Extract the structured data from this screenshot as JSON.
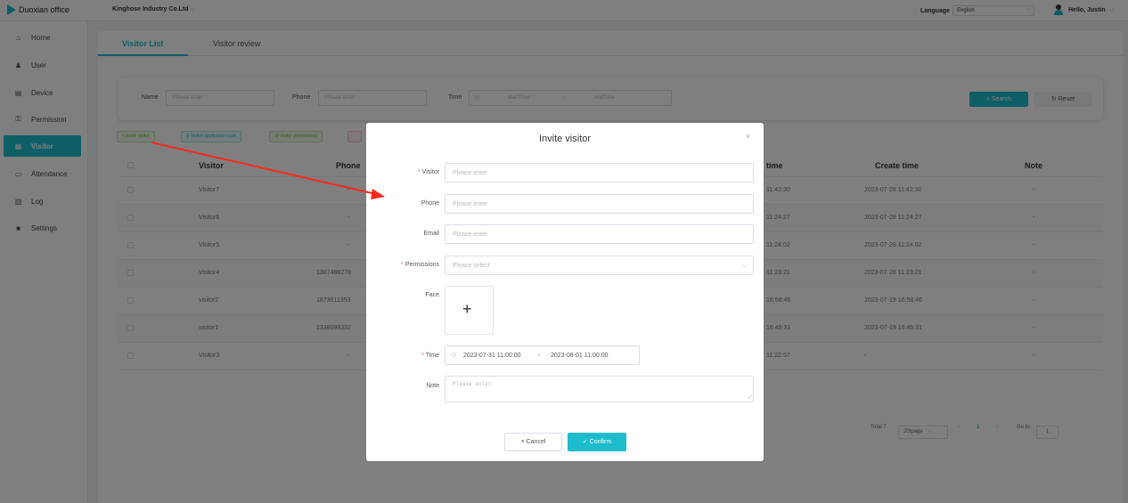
{
  "header": {
    "app_name": "Duoxian office",
    "company": "Kinghose Industry Co.Ltd",
    "language_label": "Language",
    "language_value": "English",
    "greeting": "Hello, Justin"
  },
  "sidebar": {
    "items": [
      {
        "label": "Home",
        "icon": "home-icon"
      },
      {
        "label": "User",
        "icon": "user-icon"
      },
      {
        "label": "Device",
        "icon": "device-icon"
      },
      {
        "label": "Permission",
        "icon": "permission-icon"
      },
      {
        "label": "Visitor",
        "icon": "visitor-icon",
        "active": true
      },
      {
        "label": "Attendance",
        "icon": "attendance-icon"
      },
      {
        "label": "Log",
        "icon": "log-icon"
      },
      {
        "label": "Settings",
        "icon": "settings-icon"
      }
    ]
  },
  "tabs": [
    {
      "label": "Visitor List",
      "active": true
    },
    {
      "label": "Visitor review",
      "active": false
    }
  ],
  "filter": {
    "name_label": "Name",
    "name_placeholder": "Please enter",
    "phone_label": "Phone",
    "phone_placeholder": "Please enter",
    "time_label": "Time",
    "start_placeholder": "startTime",
    "time_separator": "-",
    "end_placeholder": "endTime",
    "search_label": "Search",
    "reset_label": "Reset"
  },
  "toolbar": {
    "invite": "+ Invite visitor",
    "app_code": "Visitor application code",
    "permissions": "Visitor permissions"
  },
  "table": {
    "columns": {
      "visitor": "Visitor",
      "phone": "Phone",
      "time": "time",
      "create_time": "Create time",
      "note": "Note"
    },
    "rows": [
      {
        "visitor": "Visitor7",
        "phone": "-",
        "time": "11:42:30",
        "create": "2023-07-28 11:42:30",
        "note": "-"
      },
      {
        "visitor": "Visitor6",
        "phone": "-",
        "time": "11:24:27",
        "create": "2023-07-28 11:24:27",
        "note": "-"
      },
      {
        "visitor": "Visitor5",
        "phone": "-",
        "time": "11:24:02",
        "create": "2023-07-28 11:24:02",
        "note": "-"
      },
      {
        "visitor": "Visitor4",
        "phone": "1387488278",
        "time": "11:23:21",
        "create": "2023-07-28 11:23:21",
        "note": "-"
      },
      {
        "visitor": "visitor2",
        "phone": "1873611353",
        "time": "16:58:46",
        "create": "2023-07-19 16:58:46",
        "note": "-"
      },
      {
        "visitor": "visitor1",
        "phone": "1338099332",
        "time": "16:45:31",
        "create": "2023-07-19 16:45:31",
        "note": "-"
      },
      {
        "visitor": "Visitor3",
        "phone": "-",
        "time": "11:22:57",
        "create": "-",
        "note": "-"
      }
    ]
  },
  "pagination": {
    "total": "Total 7",
    "page_size": "20/page",
    "current_page": "1",
    "goto_label": "Go to",
    "goto_value": "1"
  },
  "modal": {
    "title": "Invite visitor",
    "visitor_label": "Visitor",
    "visitor_placeholder": "Please enter",
    "phone_label": "Phone",
    "phone_placeholder": "Please enter",
    "email_label": "Email",
    "email_placeholder": "Please enter",
    "permissions_label": "Permissions",
    "permissions_placeholder": "Please select",
    "face_label": "Face",
    "time_label": "Time",
    "start_time": "2023-07-31 11:00:00",
    "time_separator": "-",
    "end_time": "2023-08-01 11:00:00",
    "note_label": "Note",
    "note_placeholder": "Please enter",
    "cancel_label": "Cancel",
    "confirm_label": "Confirm"
  },
  "colors": {
    "accent": "#1dbccc",
    "required": "#f56c6c",
    "annotation_arrow": "#ff2a1a"
  }
}
